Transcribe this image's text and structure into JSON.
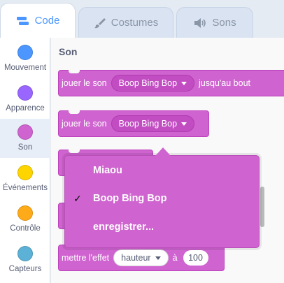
{
  "tabs": [
    {
      "label": "Code",
      "icon": "code-icon",
      "active": true
    },
    {
      "label": "Costumes",
      "icon": "brush-icon",
      "active": false
    },
    {
      "label": "Sons",
      "icon": "speaker-icon",
      "active": false
    }
  ],
  "categories": [
    {
      "label": "Mouvement",
      "color": "#4c97ff"
    },
    {
      "label": "Apparence",
      "color": "#9966ff"
    },
    {
      "label": "Son",
      "color": "#cf63cf",
      "selected": true
    },
    {
      "label": "Événements",
      "color": "#ffd500"
    },
    {
      "label": "Contrôle",
      "color": "#ffab19"
    },
    {
      "label": "Capteurs",
      "color": "#5cb1d6"
    }
  ],
  "palette": {
    "heading": "Son",
    "block1": {
      "prefix": "jouer le son",
      "sound": "Boop Bing Bop",
      "suffix": "jusqu'au bout"
    },
    "block2": {
      "prefix": "jouer le son",
      "sound": "Boop Bing Bop"
    },
    "block5": {
      "prefix": "mettre l'effet",
      "effect": "hauteur",
      "mid": "à",
      "value": "100"
    }
  },
  "dropdown": {
    "options": [
      {
        "label": "Miaou",
        "checked": false
      },
      {
        "label": "Boop Bing Bop",
        "checked": true
      },
      {
        "label": "enregistrer...",
        "checked": false
      }
    ],
    "check_mark": "✓"
  },
  "colors": {
    "sound": "#cf63cf",
    "accent": "#4c97ff"
  }
}
